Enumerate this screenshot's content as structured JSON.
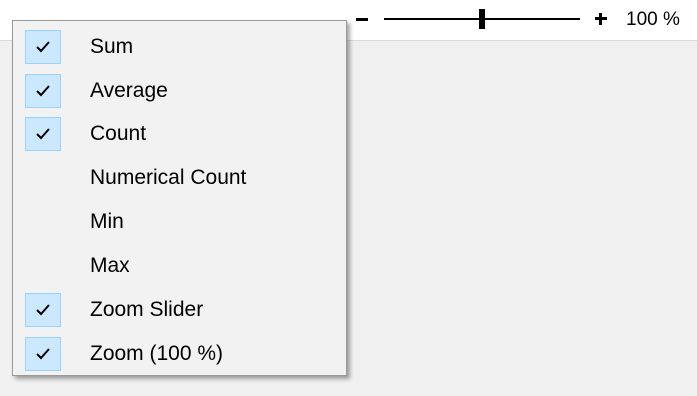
{
  "zoom": {
    "minus_icon": "minus-icon",
    "plus_icon": "plus-icon",
    "slider_value": 0.5,
    "level_text": "100 %"
  },
  "menu": {
    "items": [
      {
        "label": "Sum",
        "checked": true
      },
      {
        "label": "Average",
        "checked": true
      },
      {
        "label": "Count",
        "checked": true
      },
      {
        "label": "Numerical Count",
        "checked": false
      },
      {
        "label": "Min",
        "checked": false
      },
      {
        "label": "Max",
        "checked": false
      },
      {
        "label": "Zoom Slider",
        "checked": true
      },
      {
        "label": "Zoom (100 %)",
        "checked": true
      }
    ]
  },
  "colors": {
    "check_highlight": "#cce8ff",
    "check_border": "#99d1ff",
    "menu_background": "#f2f2f2"
  }
}
